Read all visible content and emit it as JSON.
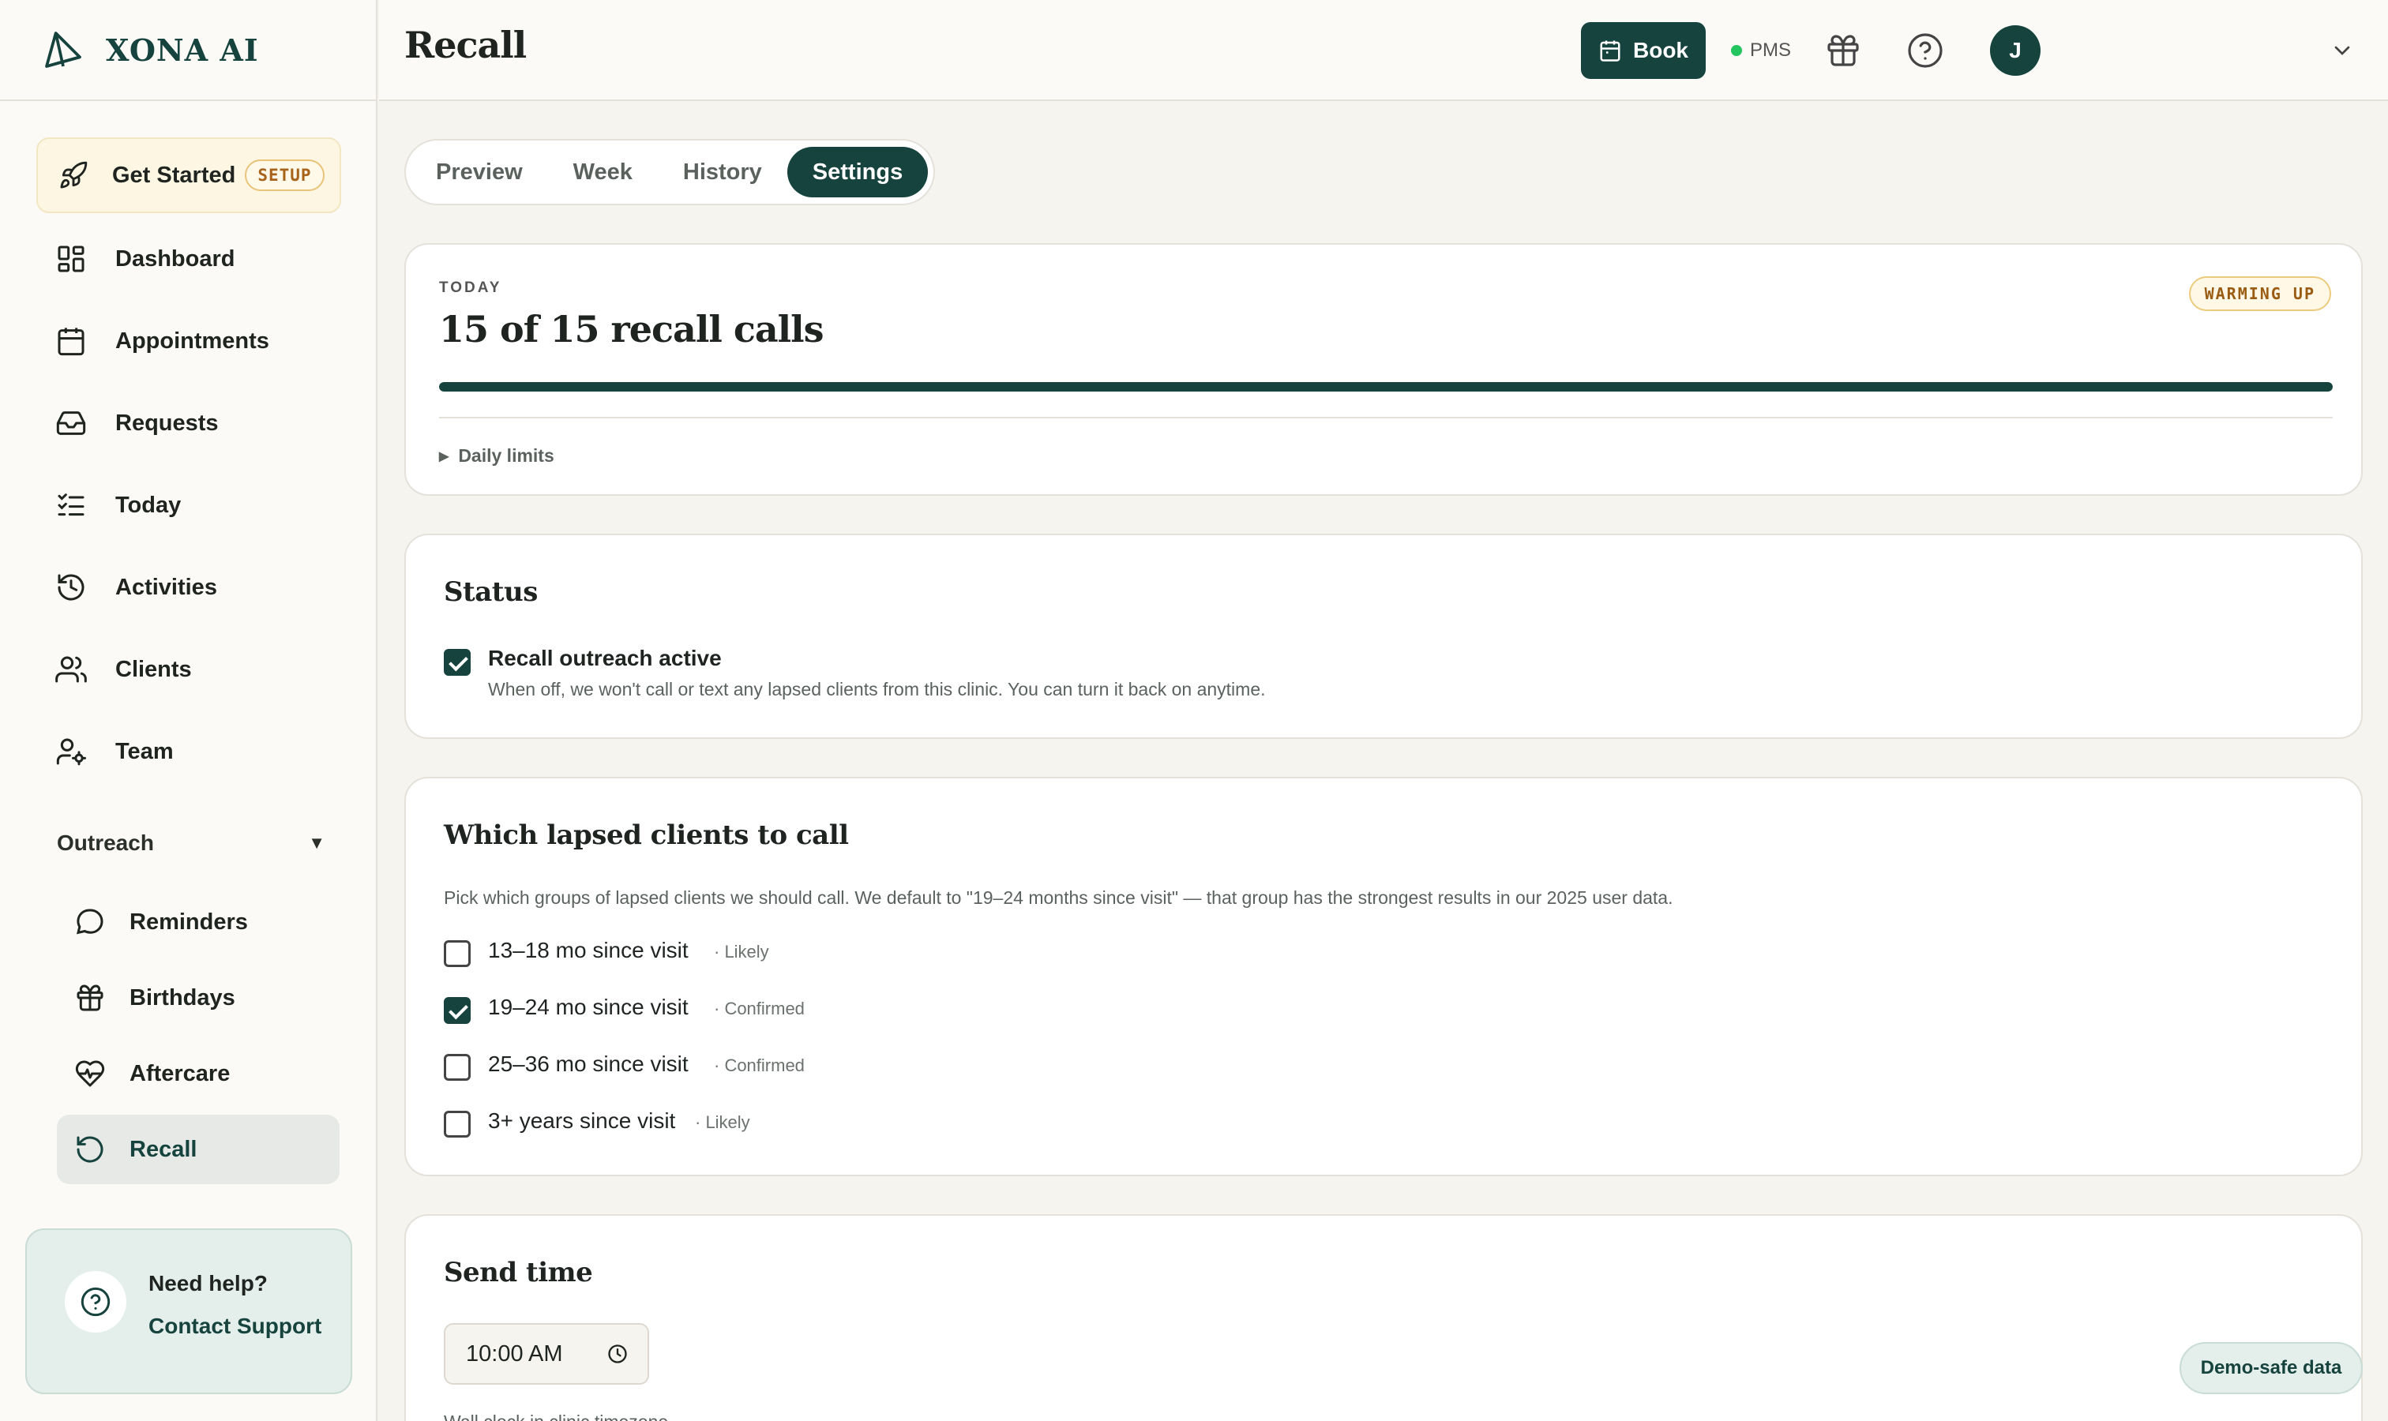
{
  "brand": {
    "name": "XONA AI"
  },
  "sidebar": {
    "get_started": {
      "label": "Get Started",
      "badge": "SETUP"
    },
    "items": [
      {
        "label": "Dashboard",
        "icon": "dashboard-icon"
      },
      {
        "label": "Appointments",
        "icon": "calendar-icon"
      },
      {
        "label": "Requests",
        "icon": "inbox-icon"
      },
      {
        "label": "Today",
        "icon": "checklist-icon"
      },
      {
        "label": "Activities",
        "icon": "history-icon"
      },
      {
        "label": "Clients",
        "icon": "users-icon"
      },
      {
        "label": "Team",
        "icon": "user-gear-icon"
      }
    ],
    "outreach": {
      "label": "Outreach",
      "toggle": "▼",
      "items": [
        {
          "label": "Reminders",
          "icon": "chat-bubble-icon"
        },
        {
          "label": "Birthdays",
          "icon": "gift-icon"
        },
        {
          "label": "Aftercare",
          "icon": "heart-pulse-icon"
        },
        {
          "label": "Recall",
          "icon": "rotate-ccw-icon",
          "active": true
        }
      ]
    },
    "help": {
      "title": "Need help?",
      "link": "Contact Support"
    }
  },
  "header": {
    "title": "Recall",
    "book_label": "Book",
    "pms_label": "PMS",
    "pms_status_color": "#22c55e",
    "avatar_initial": "J"
  },
  "tabs": [
    {
      "label": "Preview",
      "active": false
    },
    {
      "label": "Week",
      "active": false
    },
    {
      "label": "History",
      "active": false
    },
    {
      "label": "Settings",
      "active": true
    }
  ],
  "today_card": {
    "eyebrow": "TODAY",
    "count_text": "15 of 15 recall calls",
    "badge": "WARMING UP",
    "progress": 1.0,
    "daily_limits_label": "Daily limits"
  },
  "status_card": {
    "title": "Status",
    "option_label": "Recall outreach active",
    "option_checked": true,
    "option_help": "When off, we won't call or text any lapsed clients from this clinic. You can turn it back on anytime."
  },
  "lapsed_card": {
    "title": "Which lapsed clients to call",
    "description": "Pick which groups of lapsed clients we should call. We default to \"19–24 months since visit\" — that group has the strongest results in our 2025 user data.",
    "options": [
      {
        "label": "13–18 mo since visit",
        "tag": "· Likely",
        "checked": false
      },
      {
        "label": "19–24 mo since visit",
        "tag": "· Confirmed",
        "checked": true
      },
      {
        "label": "25–36 mo since visit",
        "tag": "· Confirmed",
        "checked": false
      },
      {
        "label": "3+ years since visit",
        "tag": "· Likely",
        "checked": false
      }
    ]
  },
  "send_card": {
    "title": "Send time",
    "time_value": "10:00 AM",
    "timezone_note": "Wall clock in clinic timezone"
  },
  "demo_pill": "Demo-safe data",
  "colors": {
    "brand": "#16433e",
    "accent_warning": "#9a5b12",
    "background": "#f6f4ef"
  }
}
